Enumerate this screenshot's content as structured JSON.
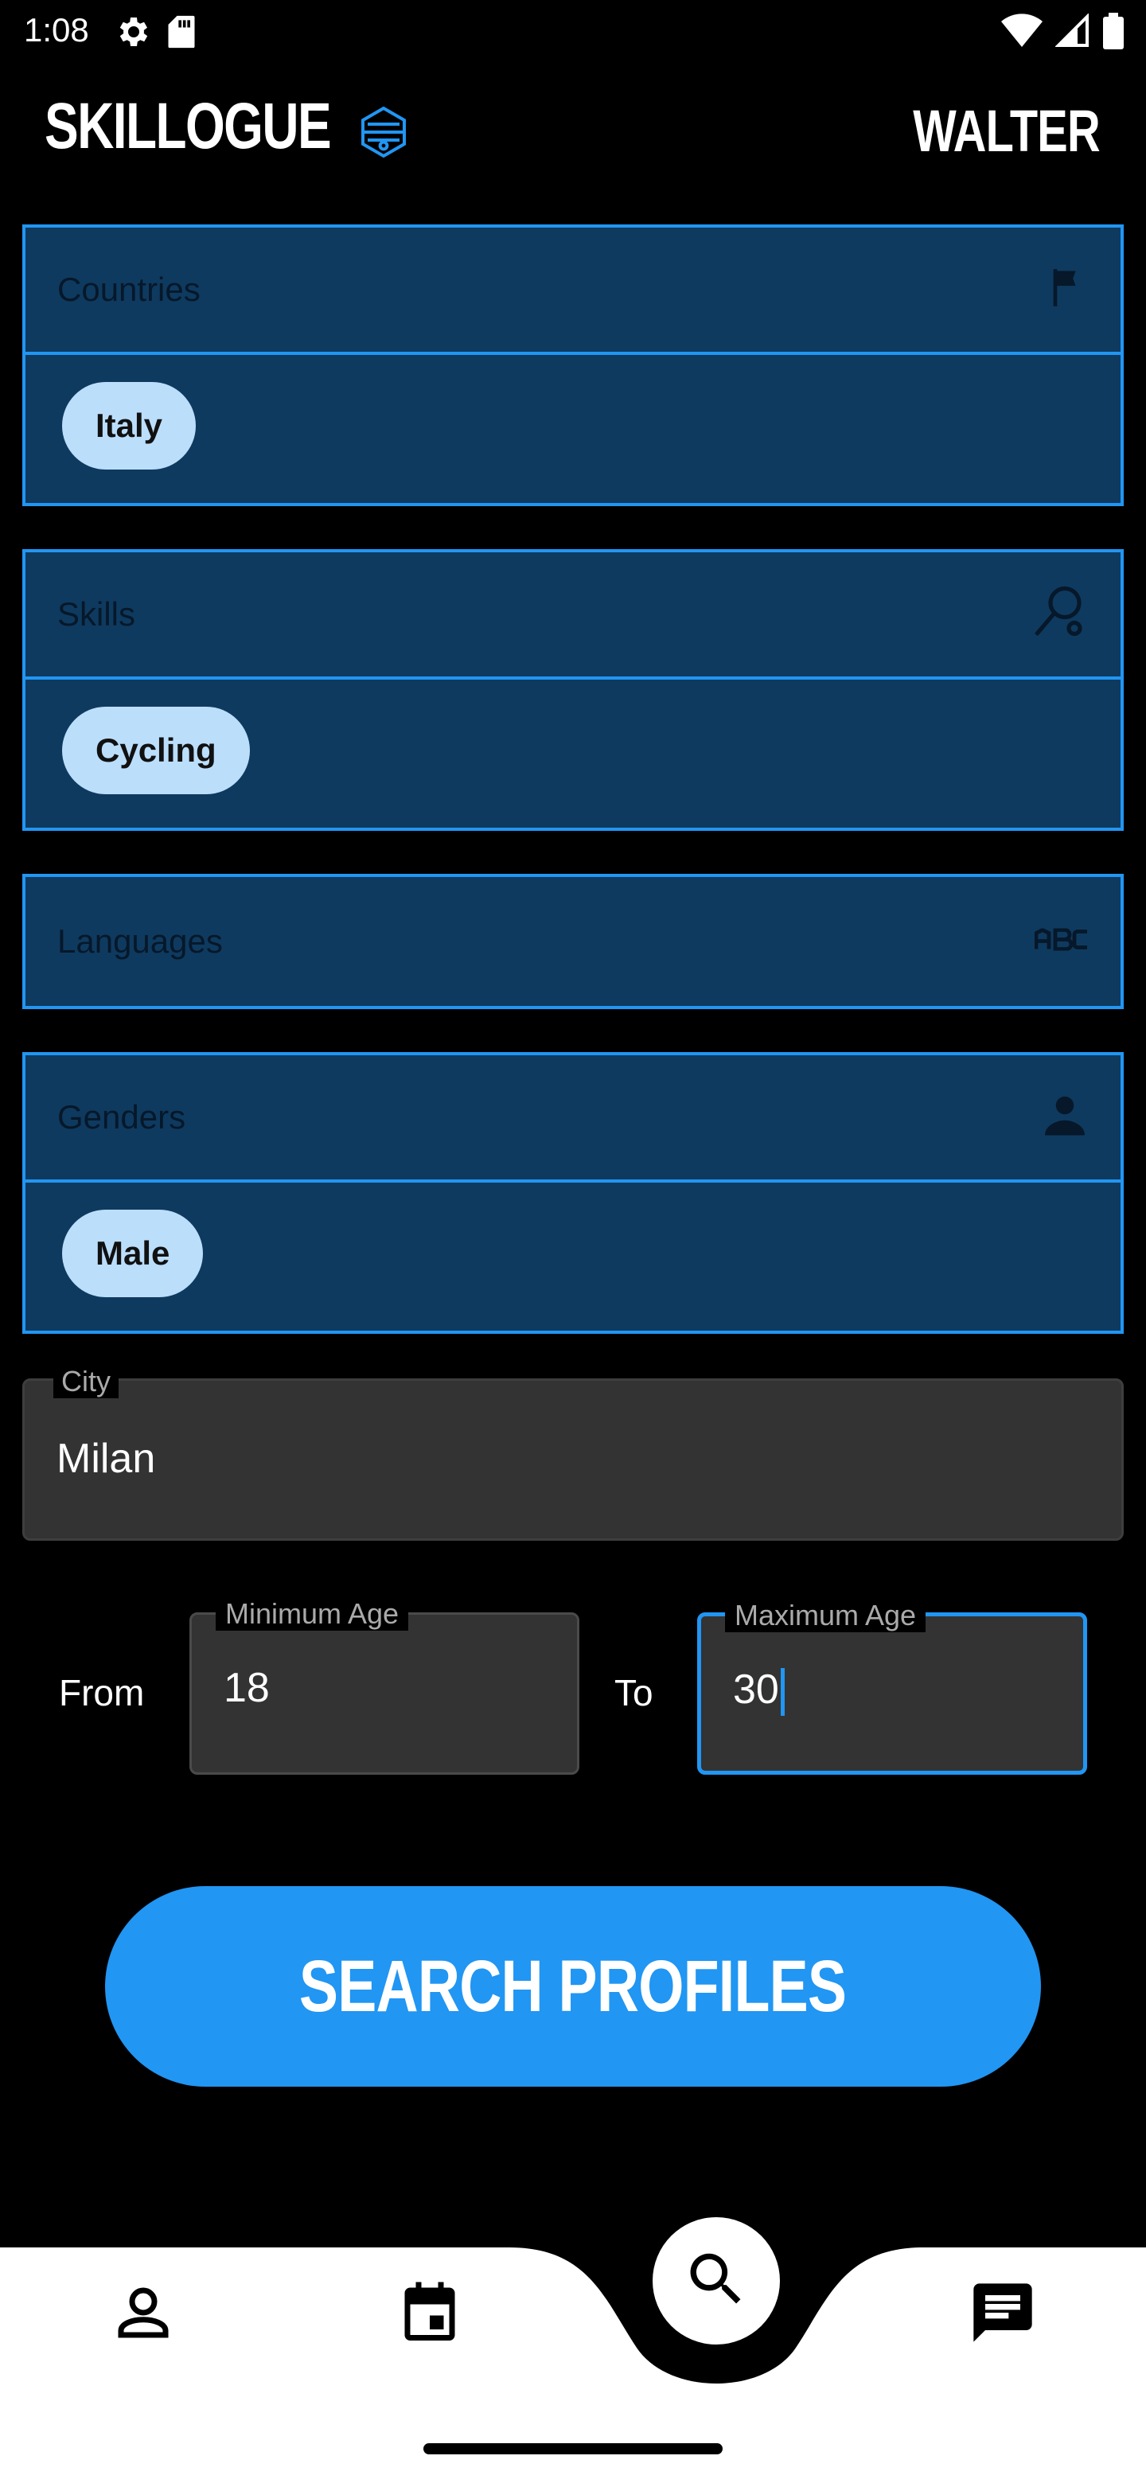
{
  "status_bar": {
    "time": "1:08",
    "left_icons": [
      "settings-icon",
      "sd-card-icon"
    ],
    "right_icons": [
      "wifi-icon",
      "signal-icon",
      "battery-icon"
    ]
  },
  "app_bar": {
    "title": "SKILLOGUE",
    "logo_icon": "hive-logo-icon",
    "user": "WALTER"
  },
  "filters": {
    "countries": {
      "label": "Countries",
      "icon": "flag-icon",
      "chips": [
        "Italy"
      ]
    },
    "skills": {
      "label": "Skills",
      "icon": "racket-icon",
      "chips": [
        "Cycling"
      ]
    },
    "languages": {
      "label": "Languages",
      "icon": "abc-icon",
      "chips": []
    },
    "genders": {
      "label": "Genders",
      "icon": "person-icon",
      "chips": [
        "Male"
      ]
    }
  },
  "city": {
    "label": "City",
    "value": "Milan"
  },
  "age": {
    "from_label": "From",
    "to_label": "To",
    "min": {
      "label": "Minimum Age",
      "value": "18"
    },
    "max": {
      "label": "Maximum Age",
      "value": "30"
    }
  },
  "search_button": {
    "label": "SEARCH PROFILES"
  },
  "bottom_nav": {
    "items": [
      "profile-icon",
      "calendar-icon",
      "search-icon",
      "chat-icon"
    ],
    "active": "search-icon"
  },
  "colors": {
    "accent": "#2196f3",
    "card_fill": "#0f3a5f",
    "chip_fill": "#bbdefb",
    "field_fill": "#333333",
    "background": "#000000"
  }
}
